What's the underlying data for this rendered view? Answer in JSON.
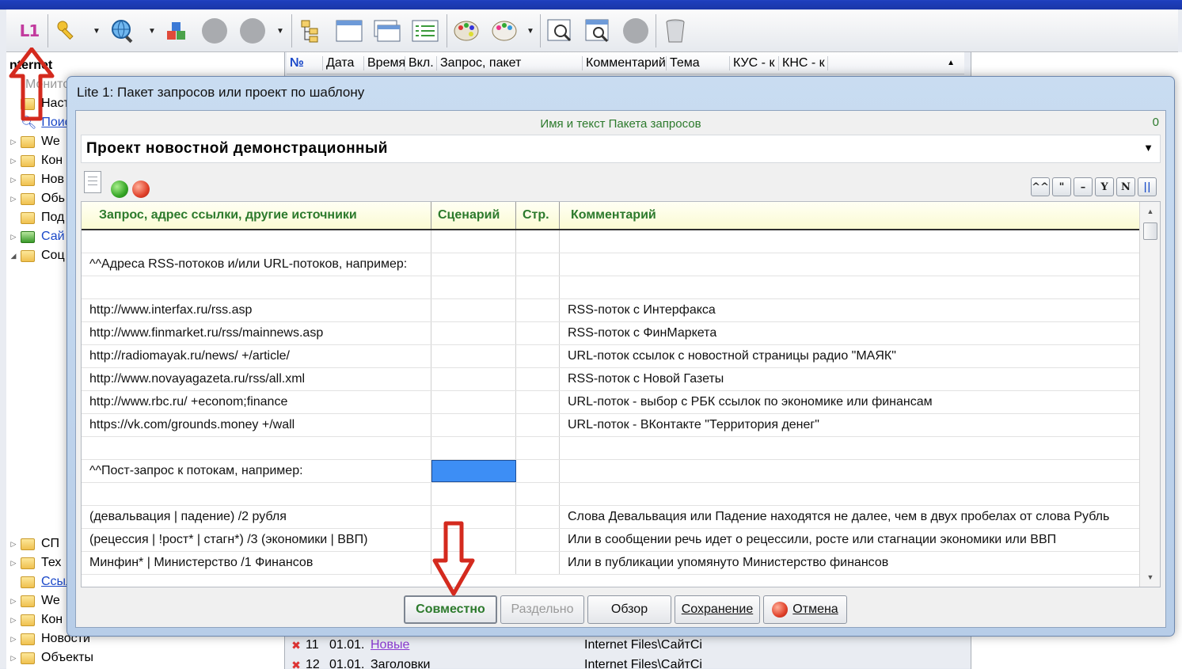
{
  "toolbar": {
    "logo_label": "L1",
    "buttons": [
      "l1-icon",
      "key-icon",
      "globe-search-icon",
      "blocks-icon",
      "gray-circle-icon",
      "gray-circle-icon",
      "tree-icon",
      "window-icon",
      "windows-icon",
      "list-icon",
      "palette-icon",
      "palette-icon",
      "zoom-icon",
      "calendar-zoom-icon",
      "gray-circle-icon",
      "trash-icon"
    ]
  },
  "left_panel": {
    "title": "nternet",
    "rows": [
      {
        "label": "Монито",
        "kind": "text"
      },
      {
        "label": "Настро",
        "kind": "folder"
      },
      {
        "label": "Поиск",
        "kind": "link"
      },
      {
        "label": "We",
        "kind": "folder"
      },
      {
        "label": "Кон",
        "kind": "folder"
      },
      {
        "label": "Нов",
        "kind": "folder"
      },
      {
        "label": "Обь",
        "kind": "folder"
      },
      {
        "label": "Под",
        "kind": "folder"
      },
      {
        "label": "Сай",
        "kind": "folder"
      },
      {
        "label": "Соц",
        "kind": "folder"
      },
      {
        "label": "СП",
        "kind": "folder"
      },
      {
        "label": "Тех",
        "kind": "folder"
      },
      {
        "label": "Ссылки",
        "kind": "link"
      },
      {
        "label": "We",
        "kind": "folder"
      },
      {
        "label": "Кон",
        "kind": "folder"
      },
      {
        "label": "Новости",
        "kind": "folder"
      },
      {
        "label": "Объекты",
        "kind": "folder"
      }
    ]
  },
  "list_header": [
    "№",
    "Дата",
    "Время",
    "Вкл.",
    "Запрос, пакет",
    "Комментарий",
    "Тема",
    "КУС - к",
    "КНС - к"
  ],
  "bg_rows": [
    {
      "num": "11",
      "date": "01.01.",
      "query": "Новые",
      "path": "Internet Files\\СайтСі"
    },
    {
      "num": "12",
      "date": "01.01.",
      "query": "Заголовки",
      "path": "Internet Files\\СайтСі"
    }
  ],
  "dialog": {
    "title": "Lite 1: Пакет запросов или проект по шаблону",
    "caption": "Имя и текст Пакета запросов",
    "count": "0",
    "package_name": "Проект новостной демонстрационный",
    "format_buttons": [
      "^^",
      "\"",
      "–",
      "Y",
      "N",
      "||"
    ],
    "columns": [
      "Запрос, адрес ссылки, другие источники",
      "Сценарий",
      "Стр.",
      "Комментарий"
    ],
    "rows": [
      {
        "query": "",
        "comment": ""
      },
      {
        "query": "^^Адреса RSS-потоков и/или URL-потоков, например:",
        "comment": ""
      },
      {
        "query": "",
        "comment": ""
      },
      {
        "query": "http://www.interfax.ru/rss.asp",
        "comment": "RSS-поток с Интерфакса"
      },
      {
        "query": "http://www.finmarket.ru/rss/mainnews.asp",
        "comment": "RSS-поток с ФинМаркета"
      },
      {
        "query": "http://radiomayak.ru/news/ +/article/",
        "comment": "URL-поток ссылок с новостной страницы радио \"МАЯК\""
      },
      {
        "query": "http://www.novayagazeta.ru/rss/all.xml",
        "comment": "RSS-поток с Новой Газеты"
      },
      {
        "query": "http://www.rbc.ru/ +econom;finance",
        "comment": "URL-поток - выбор с РБК ссылок по экономике или финансам"
      },
      {
        "query": "https://vk.com/grounds.money +/wall",
        "comment": "URL-поток - ВКонтакте \"Территория денег\""
      },
      {
        "query": "",
        "comment": ""
      },
      {
        "query": "^^Пост-запрос к потокам, например:",
        "comment": ""
      },
      {
        "query": "",
        "comment": ""
      },
      {
        "query": "(девальвация | падение) /2 рубля",
        "comment": "Слова Девальвация или Падение находятся не далее, чем в двух пробелах от слова Рубль"
      },
      {
        "query": "(рецессия | !рост* | стагн*) /3 (экономики | ВВП)",
        "comment": "Или в сообщении речь идет о рецессили, росте или стагнации экономики или ВВП"
      },
      {
        "query": "Минфин* | Министерство /1 Финансов",
        "comment": "Или в публикации упомянуто Министерство финансов"
      }
    ],
    "buttons": {
      "together": "Совместно",
      "separate": "Раздельно",
      "browse": "Обзор",
      "save": "Сохранение",
      "cancel": "Отмена"
    }
  },
  "colors": {
    "accent_green": "#2c7a2c",
    "selection_blue": "#3d8ef5",
    "arrow_red": "#d42a1e"
  }
}
